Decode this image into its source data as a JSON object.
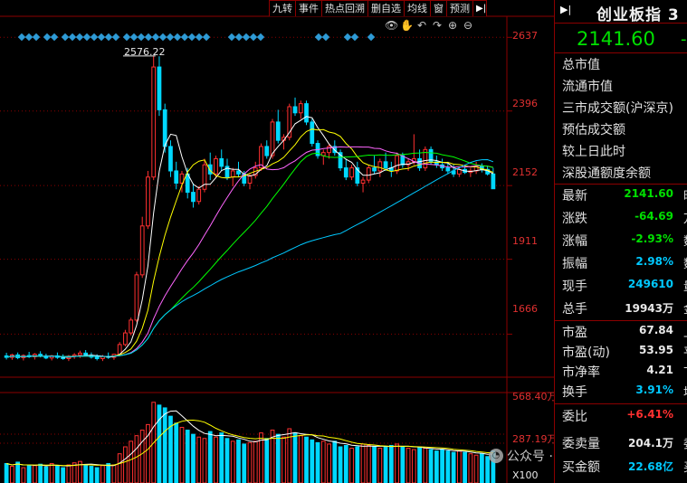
{
  "toolbar": [
    {
      "name": "jiuzhuan",
      "label": "九转"
    },
    {
      "name": "events",
      "label": "事件"
    },
    {
      "name": "hotspot-review",
      "label": "热点回溯"
    },
    {
      "name": "delete-self-select",
      "label": "删自选"
    },
    {
      "name": "ma-line",
      "label": "均线"
    },
    {
      "name": "window",
      "label": "窗"
    },
    {
      "name": "forecast",
      "label": "预测"
    },
    {
      "name": "expand",
      "label": "▶|"
    }
  ],
  "chart_icons": [
    "eye-icon",
    "hand-icon",
    "undo-icon",
    "redo-icon",
    "zoom-in-icon",
    "zoom-out-icon"
  ],
  "price_axis_labels": [
    "2637",
    "2396",
    "2152",
    "1911",
    "1666"
  ],
  "volume_axis_labels": [
    "568.40万",
    "287.19万",
    "X100"
  ],
  "high_annotation": "2576.22",
  "watermark": "公众号 · 尾盘擒牛",
  "panel": {
    "title": "创业板指 3",
    "price": "2141.60",
    "price_suffix": "-",
    "text_rows": [
      "总市值",
      "流通市值",
      "三市成交额(沪深京)",
      "预估成交额",
      "较上日此时",
      "深股通额度余额"
    ],
    "quote_rows": [
      {
        "key": "最新",
        "value": "2141.60",
        "suffix": "昨",
        "color": "green"
      },
      {
        "key": "涨跌",
        "value": "-64.69",
        "suffix": "万",
        "color": "green"
      },
      {
        "key": "涨幅",
        "value": "-2.93%",
        "suffix": "数",
        "color": "green"
      },
      {
        "key": "振幅",
        "value": "2.98%",
        "suffix": "数",
        "color": "cyan"
      },
      {
        "key": "现手",
        "value": "249610",
        "suffix": "量",
        "color": "cyan"
      },
      {
        "key": "总手",
        "value": "19943万",
        "suffix": "金",
        "color": "white"
      },
      {
        "key": "市盈",
        "value": "67.84",
        "suffix": "上",
        "color": "white"
      },
      {
        "key": "市盈(动)",
        "value": "53.95",
        "suffix": "平",
        "color": "white"
      },
      {
        "key": "市净率",
        "value": "4.21",
        "suffix": "下",
        "color": "white"
      },
      {
        "key": "换手",
        "value": "3.91%",
        "suffix": "均",
        "color": "cyan"
      },
      {
        "key": "委比",
        "value": "+6.41%",
        "suffix": "",
        "color": "red"
      },
      {
        "key": "委卖量",
        "value": "204.1万",
        "suffix": "委",
        "color": "white"
      },
      {
        "key": "买金额",
        "value": "22.68亿",
        "suffix": "买",
        "color": "cyan"
      }
    ]
  },
  "colors": {
    "up": "#ff3030",
    "down": "#00d8ff",
    "ma5": "#ffffff",
    "ma10": "#ffff00",
    "ma20": "#ff66ff",
    "ma30": "#00ff00",
    "ma60": "#00c8ff",
    "grid": "#8b0000",
    "marker": "#2e9bd6"
  },
  "chart_data": {
    "type": "candlestick",
    "y_range": [
      1540,
      2700
    ],
    "volume_range": [
      0,
      650
    ],
    "volume_unit": "万",
    "candles": [
      {
        "o": 1595,
        "h": 1605,
        "l": 1583,
        "c": 1590
      },
      {
        "o": 1590,
        "h": 1602,
        "l": 1582,
        "c": 1598
      },
      {
        "o": 1598,
        "h": 1606,
        "l": 1584,
        "c": 1589
      },
      {
        "o": 1589,
        "h": 1600,
        "l": 1580,
        "c": 1596
      },
      {
        "o": 1596,
        "h": 1608,
        "l": 1588,
        "c": 1592
      },
      {
        "o": 1592,
        "h": 1604,
        "l": 1583,
        "c": 1600
      },
      {
        "o": 1600,
        "h": 1610,
        "l": 1590,
        "c": 1594
      },
      {
        "o": 1594,
        "h": 1602,
        "l": 1584,
        "c": 1588
      },
      {
        "o": 1588,
        "h": 1598,
        "l": 1580,
        "c": 1595
      },
      {
        "o": 1595,
        "h": 1606,
        "l": 1585,
        "c": 1590
      },
      {
        "o": 1590,
        "h": 1600,
        "l": 1582,
        "c": 1586
      },
      {
        "o": 1586,
        "h": 1598,
        "l": 1578,
        "c": 1594
      },
      {
        "o": 1594,
        "h": 1604,
        "l": 1585,
        "c": 1598
      },
      {
        "o": 1598,
        "h": 1612,
        "l": 1588,
        "c": 1604
      },
      {
        "o": 1604,
        "h": 1614,
        "l": 1594,
        "c": 1597
      },
      {
        "o": 1597,
        "h": 1606,
        "l": 1586,
        "c": 1591
      },
      {
        "o": 1591,
        "h": 1600,
        "l": 1580,
        "c": 1586
      },
      {
        "o": 1586,
        "h": 1598,
        "l": 1578,
        "c": 1593
      },
      {
        "o": 1593,
        "h": 1606,
        "l": 1585,
        "c": 1590
      },
      {
        "o": 1590,
        "h": 1602,
        "l": 1582,
        "c": 1600
      },
      {
        "o": 1600,
        "h": 1640,
        "l": 1596,
        "c": 1632
      },
      {
        "o": 1632,
        "h": 1680,
        "l": 1626,
        "c": 1670
      },
      {
        "o": 1670,
        "h": 1720,
        "l": 1662,
        "c": 1712
      },
      {
        "o": 1712,
        "h": 1870,
        "l": 1705,
        "c": 1860
      },
      {
        "o": 1860,
        "h": 2050,
        "l": 1850,
        "c": 2020
      },
      {
        "o": 2020,
        "h": 2200,
        "l": 2010,
        "c": 2180
      },
      {
        "o": 2180,
        "h": 2576,
        "l": 2170,
        "c": 2540
      },
      {
        "o": 2540,
        "h": 2575,
        "l": 2380,
        "c": 2400
      },
      {
        "o": 2400,
        "h": 2420,
        "l": 2260,
        "c": 2280
      },
      {
        "o": 2280,
        "h": 2300,
        "l": 2180,
        "c": 2200
      },
      {
        "o": 2200,
        "h": 2230,
        "l": 2140,
        "c": 2160
      },
      {
        "o": 2160,
        "h": 2200,
        "l": 2130,
        "c": 2190
      },
      {
        "o": 2190,
        "h": 2210,
        "l": 2110,
        "c": 2130
      },
      {
        "o": 2130,
        "h": 2160,
        "l": 2080,
        "c": 2100
      },
      {
        "o": 2100,
        "h": 2150,
        "l": 2090,
        "c": 2140
      },
      {
        "o": 2140,
        "h": 2240,
        "l": 2130,
        "c": 2220
      },
      {
        "o": 2220,
        "h": 2260,
        "l": 2170,
        "c": 2190
      },
      {
        "o": 2190,
        "h": 2250,
        "l": 2180,
        "c": 2240
      },
      {
        "o": 2240,
        "h": 2270,
        "l": 2200,
        "c": 2215
      },
      {
        "o": 2215,
        "h": 2240,
        "l": 2170,
        "c": 2180
      },
      {
        "o": 2180,
        "h": 2210,
        "l": 2150,
        "c": 2200
      },
      {
        "o": 2200,
        "h": 2230,
        "l": 2180,
        "c": 2190
      },
      {
        "o": 2190,
        "h": 2200,
        "l": 2150,
        "c": 2160
      },
      {
        "o": 2160,
        "h": 2190,
        "l": 2140,
        "c": 2185
      },
      {
        "o": 2185,
        "h": 2230,
        "l": 2175,
        "c": 2210
      },
      {
        "o": 2210,
        "h": 2290,
        "l": 2200,
        "c": 2280
      },
      {
        "o": 2280,
        "h": 2300,
        "l": 2240,
        "c": 2250
      },
      {
        "o": 2250,
        "h": 2370,
        "l": 2240,
        "c": 2360
      },
      {
        "o": 2360,
        "h": 2400,
        "l": 2290,
        "c": 2300
      },
      {
        "o": 2300,
        "h": 2320,
        "l": 2270,
        "c": 2310
      },
      {
        "o": 2310,
        "h": 2420,
        "l": 2300,
        "c": 2410
      },
      {
        "o": 2410,
        "h": 2440,
        "l": 2380,
        "c": 2390
      },
      {
        "o": 2390,
        "h": 2430,
        "l": 2370,
        "c": 2420
      },
      {
        "o": 2420,
        "h": 2430,
        "l": 2350,
        "c": 2360
      },
      {
        "o": 2360,
        "h": 2370,
        "l": 2280,
        "c": 2290
      },
      {
        "o": 2290,
        "h": 2300,
        "l": 2240,
        "c": 2250
      },
      {
        "o": 2250,
        "h": 2270,
        "l": 2220,
        "c": 2260
      },
      {
        "o": 2260,
        "h": 2290,
        "l": 2240,
        "c": 2280
      },
      {
        "o": 2280,
        "h": 2300,
        "l": 2250,
        "c": 2260
      },
      {
        "o": 2260,
        "h": 2270,
        "l": 2200,
        "c": 2210
      },
      {
        "o": 2210,
        "h": 2240,
        "l": 2170,
        "c": 2180
      },
      {
        "o": 2180,
        "h": 2220,
        "l": 2170,
        "c": 2210
      },
      {
        "o": 2210,
        "h": 2230,
        "l": 2150,
        "c": 2160
      },
      {
        "o": 2160,
        "h": 2180,
        "l": 2130,
        "c": 2170
      },
      {
        "o": 2170,
        "h": 2220,
        "l": 2160,
        "c": 2210
      },
      {
        "o": 2210,
        "h": 2250,
        "l": 2190,
        "c": 2200
      },
      {
        "o": 2200,
        "h": 2240,
        "l": 2180,
        "c": 2230
      },
      {
        "o": 2230,
        "h": 2260,
        "l": 2200,
        "c": 2210
      },
      {
        "o": 2210,
        "h": 2230,
        "l": 2180,
        "c": 2200
      },
      {
        "o": 2200,
        "h": 2260,
        "l": 2190,
        "c": 2250
      },
      {
        "o": 2250,
        "h": 2260,
        "l": 2210,
        "c": 2220
      },
      {
        "o": 2220,
        "h": 2240,
        "l": 2200,
        "c": 2230
      },
      {
        "o": 2230,
        "h": 2320,
        "l": 2220,
        "c": 2240
      },
      {
        "o": 2240,
        "h": 2270,
        "l": 2200,
        "c": 2210
      },
      {
        "o": 2210,
        "h": 2280,
        "l": 2200,
        "c": 2270
      },
      {
        "o": 2270,
        "h": 2280,
        "l": 2220,
        "c": 2230
      },
      {
        "o": 2230,
        "h": 2250,
        "l": 2210,
        "c": 2220
      },
      {
        "o": 2220,
        "h": 2240,
        "l": 2200,
        "c": 2210
      },
      {
        "o": 2210,
        "h": 2230,
        "l": 2190,
        "c": 2200
      },
      {
        "o": 2200,
        "h": 2220,
        "l": 2180,
        "c": 2190
      },
      {
        "o": 2190,
        "h": 2210,
        "l": 2180,
        "c": 2205
      },
      {
        "o": 2205,
        "h": 2220,
        "l": 2190,
        "c": 2195
      },
      {
        "o": 2195,
        "h": 2210,
        "l": 2180,
        "c": 2200
      },
      {
        "o": 2200,
        "h": 2230,
        "l": 2190,
        "c": 2215
      },
      {
        "o": 2215,
        "h": 2225,
        "l": 2195,
        "c": 2205
      },
      {
        "o": 2205,
        "h": 2215,
        "l": 2185,
        "c": 2190
      },
      {
        "o": 2190,
        "h": 2210,
        "l": 2150,
        "c": 2141.6
      }
    ],
    "volumes": [
      140,
      120,
      150,
      110,
      130,
      125,
      135,
      115,
      140,
      120,
      110,
      130,
      145,
      155,
      130,
      120,
      110,
      125,
      140,
      130,
      210,
      260,
      300,
      340,
      380,
      420,
      580,
      560,
      540,
      480,
      430,
      400,
      380,
      350,
      330,
      320,
      370,
      330,
      360,
      320,
      300,
      310,
      280,
      290,
      300,
      360,
      320,
      380,
      350,
      330,
      390,
      360,
      340,
      330,
      310,
      290,
      300,
      280,
      300,
      260,
      270,
      250,
      260,
      280,
      270,
      260,
      250,
      260,
      270,
      280,
      260,
      250,
      240,
      260,
      250,
      240,
      230,
      240,
      230,
      220,
      230,
      220,
      210,
      200,
      210,
      190,
      230
    ]
  }
}
